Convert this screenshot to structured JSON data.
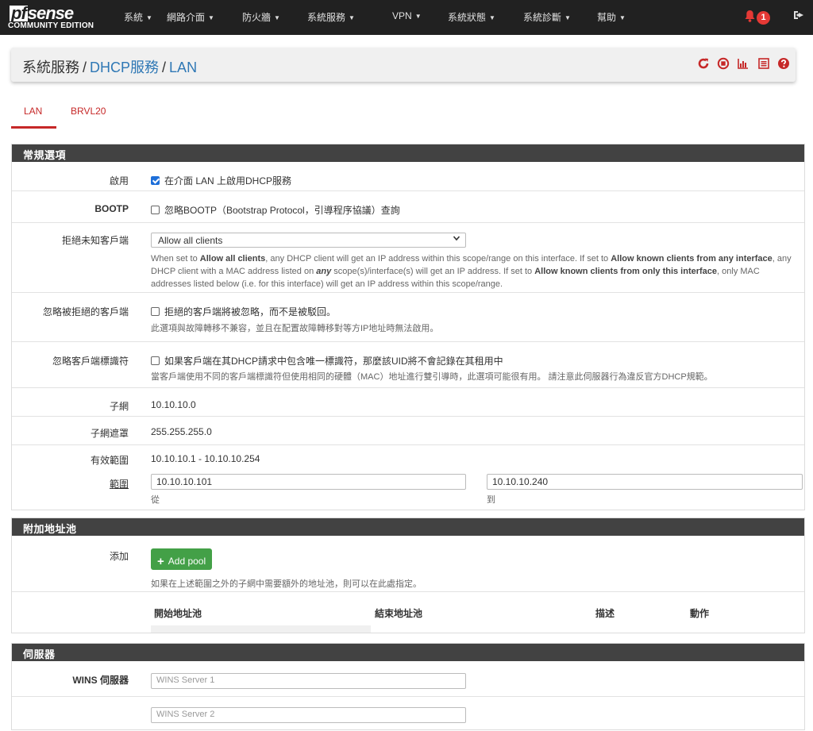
{
  "navbar": {
    "logo_main": "sense",
    "logo_pf": "pf",
    "logo_edition": "COMMUNITY EDITION",
    "menu": [
      {
        "label": "系統"
      },
      {
        "label": "網路介面"
      },
      {
        "label": "防火牆"
      },
      {
        "label": "系統服務"
      },
      {
        "label": "VPN"
      },
      {
        "label": "系統狀態"
      },
      {
        "label": "系統診斷"
      },
      {
        "label": "幫助"
      }
    ],
    "notification_count": "1",
    "icons": {
      "bell": "bell-icon",
      "logout": "logout-icon"
    }
  },
  "breadcrumb": {
    "root": "系統服務",
    "sep": "/",
    "section": "DHCP服務",
    "page": "LAN",
    "icons": [
      "restart-icon",
      "stop-icon",
      "graph-icon",
      "log-icon",
      "help-icon"
    ]
  },
  "tabs": [
    {
      "label": "LAN",
      "active": true
    },
    {
      "label": "BRVL20",
      "active": false
    }
  ],
  "general": {
    "title": "常規選項",
    "enable": {
      "label": "啟用",
      "text": "在介面 LAN 上啟用DHCP服務",
      "checked": true
    },
    "bootp": {
      "label": "BOOTP",
      "text": "忽略BOOTP（Bootstrap Protocol，引導程序協議）查詢",
      "checked": false
    },
    "deny_unknown": {
      "label": "拒絕未知客戶端",
      "selected": "Allow all clients",
      "help": [
        {
          "t": "When set to ",
          "b": false
        },
        {
          "t": "Allow all clients",
          "b": true
        },
        {
          "t": ", any DHCP client will get an IP address within this scope/range on this interface. If set to ",
          "b": false
        },
        {
          "t": "Allow known clients from any interface",
          "b": true
        },
        {
          "t": ", any DHCP client with a MAC address listed on ",
          "b": false
        },
        {
          "t": "any",
          "b": true,
          "i": true
        },
        {
          "t": " scope(s)/interface(s) will get an IP address. If set to ",
          "b": false
        },
        {
          "t": "Allow known clients from only this interface",
          "b": true
        },
        {
          "t": ", only MAC addresses listed below (i.e. for this interface) will get an IP address within this scope/range.",
          "b": false
        }
      ]
    },
    "ignore_denied": {
      "label": "忽略被拒絕的客戶端",
      "text": "拒絕的客戶端將被忽略，而不是被駁回。",
      "help": "此選項與故障轉移不兼容，並且在配置故障轉移對等方IP地址時無法啟用。",
      "checked": false
    },
    "ignore_uid": {
      "label": "忽略客戶端標識符",
      "text": "如果客戶端在其DHCP請求中包含唯一標識符，那麼該UID將不會記錄在其租用中",
      "help": "當客戶端使用不同的客戶端標識符但使用相同的硬體（MAC）地址進行雙引導時，此選項可能很有用。 請注意此伺服器行為違反官方DHCP規範。",
      "checked": false
    },
    "subnet": {
      "label": "子網",
      "value": "10.10.10.0"
    },
    "mask": {
      "label": "子網遮罩",
      "value": "255.255.255.0"
    },
    "avail_range": {
      "label": "有效範圍",
      "value": "10.10.10.1 - 10.10.10.254"
    },
    "range": {
      "label": "範圍",
      "from": "10.10.10.101",
      "from_label": "從",
      "to": "10.10.10.240",
      "to_label": "到"
    }
  },
  "pools": {
    "title": "附加地址池",
    "add_label": "添加",
    "add_button": "Add pool",
    "help": "如果在上述範圍之外的子網中需要額外的地址池，則可以在此處指定。",
    "columns": [
      "開始地址池",
      "結束地址池",
      "描述",
      "動作"
    ]
  },
  "servers": {
    "title": "伺服器",
    "wins_label": "WINS 伺服器",
    "wins1_placeholder": "WINS Server 1",
    "wins2_placeholder": "WINS Server 2"
  }
}
